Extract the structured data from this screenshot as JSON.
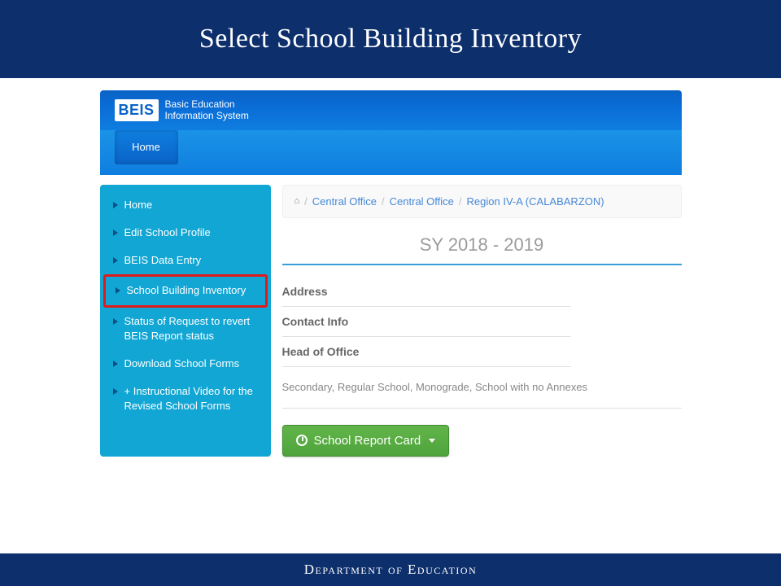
{
  "slide_title": "Select School Building Inventory",
  "header": {
    "logo_badge": "BEIS",
    "logo_line1": "Basic Education",
    "logo_line2": "Information System",
    "home_tab": "Home"
  },
  "sidebar": {
    "items": [
      {
        "label": "Home"
      },
      {
        "label": "Edit School Profile"
      },
      {
        "label": "BEIS Data Entry"
      },
      {
        "label": "School Building Inventory",
        "highlighted": true
      },
      {
        "label": "Status of Request to revert BEIS Report status"
      },
      {
        "label": "Download School Forms"
      },
      {
        "label": "+ Instructional Video for the Revised School Forms"
      }
    ]
  },
  "breadcrumb": {
    "items": [
      "Central Office",
      "Central Office",
      "Region IV-A (CALABARZON)"
    ]
  },
  "main": {
    "school_year": "SY 2018 - 2019",
    "address_label": "Address",
    "contact_label": "Contact Info",
    "head_label": "Head of Office",
    "description": "Secondary, Regular School, Monograde, School with no Annexes",
    "report_button": "School Report Card"
  },
  "footer": "Department of Education"
}
